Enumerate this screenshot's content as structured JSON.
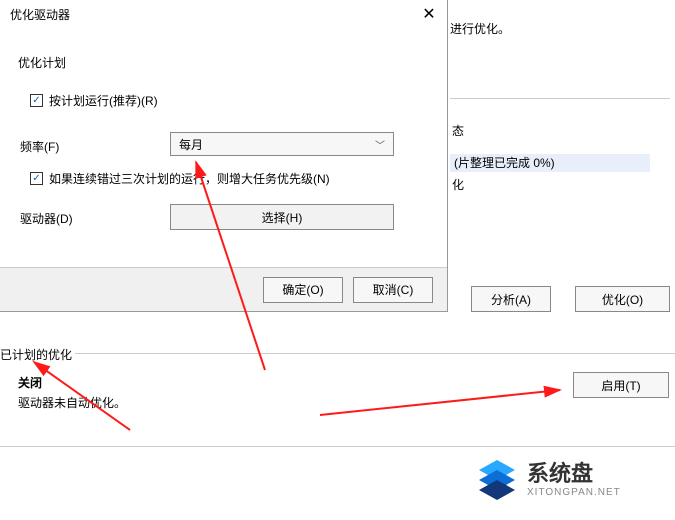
{
  "dialog": {
    "title": "优化驱动器",
    "section_title": "优化计划",
    "run_on_schedule": "按计划运行(推荐)(R)",
    "frequency_label": "频率(F)",
    "frequency_value": "每月",
    "increase_priority": "如果连续错过三次计划的运行，则增大任务优先级(N)",
    "drives_label": "驱动器(D)",
    "choose_button": "选择(H)",
    "ok_button": "确定(O)",
    "cancel_button": "取消(C)"
  },
  "back_window": {
    "hint_text": "进行优化。",
    "status_header": "态",
    "row1_text": "(片整理已完成 0%)",
    "row2_text": "化",
    "analyze_button": "分析(A)",
    "optimize_button": "优化(O)"
  },
  "scheduled": {
    "title": "已计划的优化",
    "status": "关闭",
    "desc": "驱动器未自动优化。",
    "enable_button": "启用(T)"
  },
  "watermark": {
    "cn": "系统盘",
    "en": "XITONGPAN.NET"
  }
}
